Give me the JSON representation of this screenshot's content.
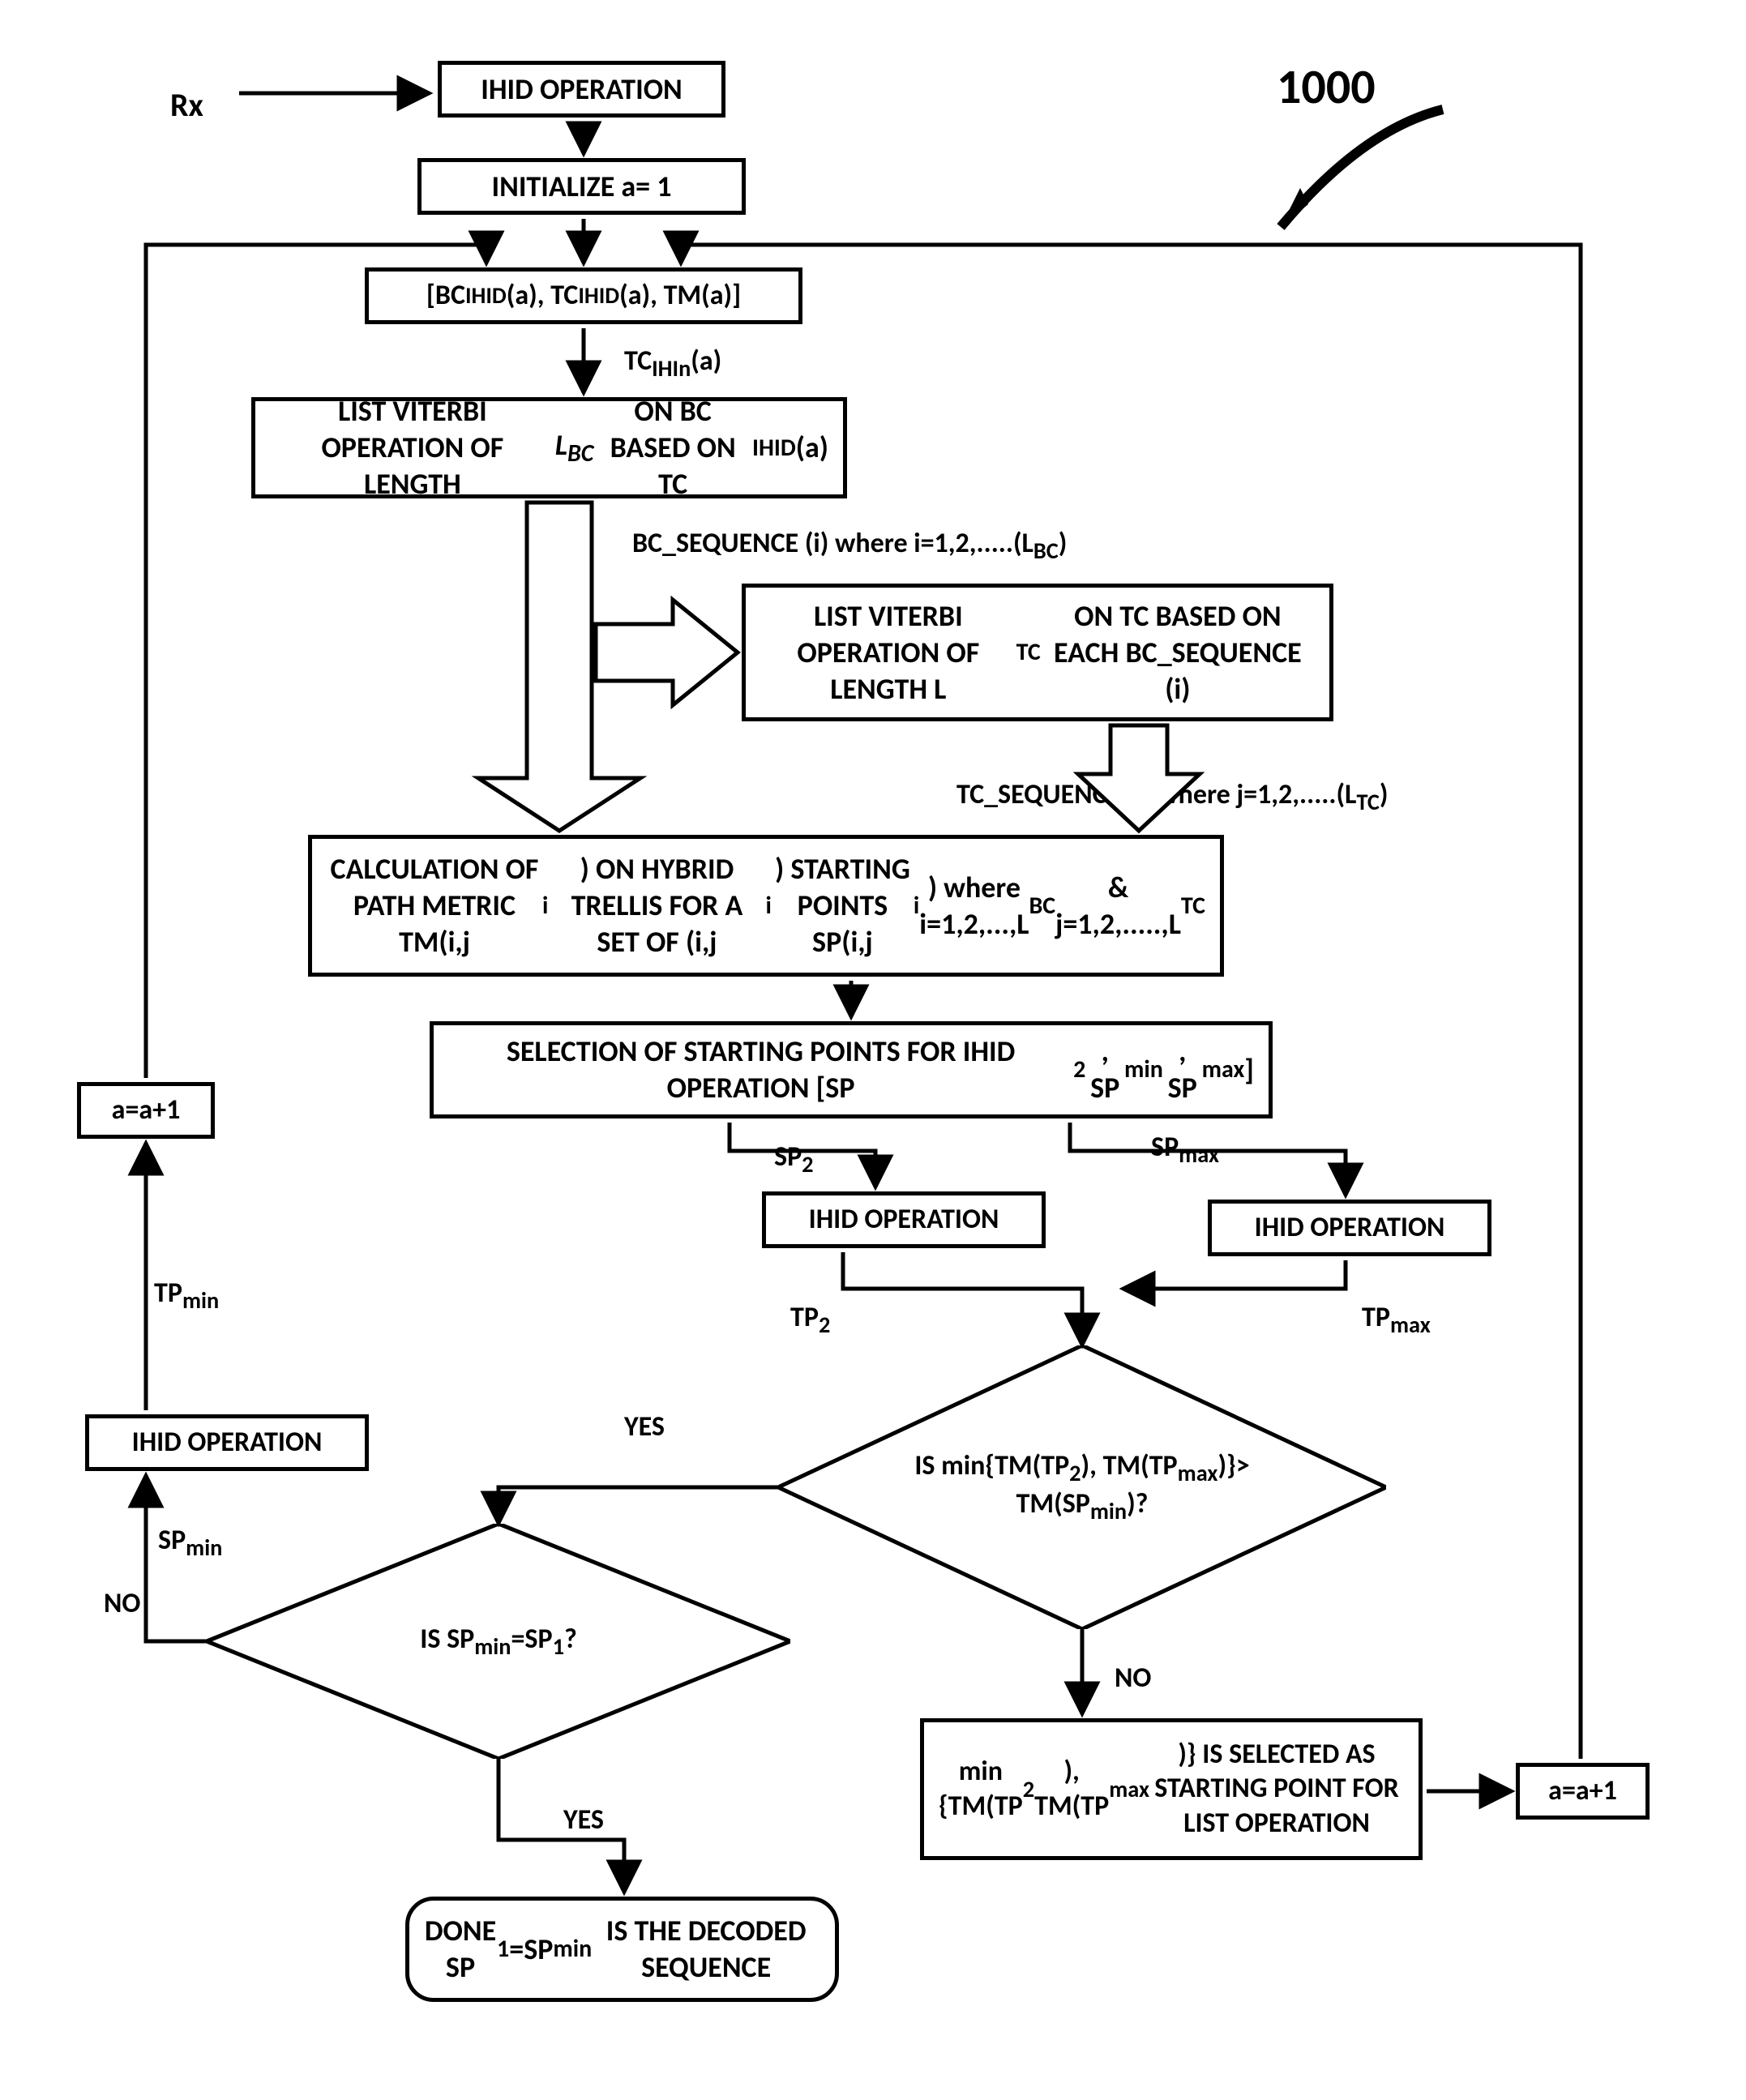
{
  "figure_number": "1000",
  "rx": "Rx",
  "steps": {
    "ihid_top": "IHID OPERATION",
    "init": "INITIALIZE  a= 1",
    "bc_tc_tm": "[BC<sub>IHID</sub>(a), TC<sub>IHID</sub>(a), TM(a)]",
    "tcihin": "TC<sub>IHIn</sub>(a)",
    "list_bc": "LIST VITERBI OPERATION OF LENGTH <span class='ital'>L<sub>BC</sub></span> ON BC BASED ON TC<sub>IHID</sub>(a)",
    "bc_seq_label": "BC_SEQUENCE (i) where i=1,2,.....(L<sub>BC</sub>)",
    "list_tc": "LIST VITERBI OPERATION OF LENGTH L<sub>TC</sub> ON TC BASED ON EACH BC_SEQUENCE (i)",
    "tc_seq_label": "TC_SEQUENCE (j) where j=1,2,.....(L<sub>TC</sub>)",
    "calc": "CALCULATION OF PATH METRIC TM(i,j<sub>i</sub>) ON HYBRID TRELLIS FOR A SET OF (i,j<sub>i</sub>) STARTING POINTS   SP(i,j<sub>i</sub>) where i=1,2,...,L<sub>BC</sub> & j=1,2,.....,L<sub>TC</sub>",
    "select_sp": "SELECTION OF STARTING POINTS FOR IHID OPERATION [SP<sub>2</sub>, SP<sub>min</sub>, SP<sub>max</sub>]",
    "sp2": "SP<sub>2</sub>",
    "spmax": "SP<sub>max</sub>",
    "ihid_sp2": "IHID OPERATION",
    "ihid_spmax": "IHID OPERATION",
    "tp2": "TP<sub>2</sub>",
    "tpmax": "TP<sub>max</sub>",
    "diamond1": "IS min{TM(TP<sub>2</sub>), TM(TP<sub>max</sub>)}&gt; TM(SP<sub>min</sub>)?",
    "no": "NO",
    "yes": "YES",
    "select_min": "min {TM(TP<sub>2</sub>), TM(TP<sub>max</sub>)} IS SELECTED AS STARTING POINT FOR LIST OPERATION",
    "a_plus_right": "a=a+1",
    "a_plus_left": "a=a+1",
    "tpmin": "TP<sub>min</sub>",
    "ihid_left": "IHID OPERATION",
    "spmin": "SP<sub>min</sub>",
    "diamond2": "IS SP<sub>min</sub>=SP<sub>1</sub>?",
    "done": "DONE SP<sub>1</sub>=SP<sub>min</sub> IS THE DECODED SEQUENCE"
  },
  "chart_data": {
    "type": "flowchart",
    "nodes": [
      {
        "id": "rx",
        "label": "Rx",
        "kind": "terminal"
      },
      {
        "id": "ihid_top",
        "label": "IHID OPERATION",
        "kind": "process"
      },
      {
        "id": "init",
        "label": "INITIALIZE a=1",
        "kind": "process"
      },
      {
        "id": "bc_tc_tm",
        "label": "[BC_IHID(a), TC_IHID(a), TM(a)]",
        "kind": "process"
      },
      {
        "id": "list_bc",
        "label": "LIST VITERBI OPERATION OF LENGTH L_BC ON BC BASED ON TC_IHID(a)",
        "kind": "process"
      },
      {
        "id": "list_tc",
        "label": "LIST VITERBI OPERATION OF LENGTH L_TC ON TC BASED ON EACH BC_SEQUENCE(i)",
        "kind": "process"
      },
      {
        "id": "calc",
        "label": "CALCULATION OF PATH METRIC TM(i,j_i) ON HYBRID TRELLIS FOR A SET OF (i,j_i) STARTING POINTS SP(i,j_i) where i=1..L_BC & j=1..L_TC",
        "kind": "process"
      },
      {
        "id": "select_sp",
        "label": "SELECTION OF STARTING POINTS FOR IHID OPERATION [SP_2, SP_min, SP_max]",
        "kind": "process"
      },
      {
        "id": "ihid_sp2",
        "label": "IHID OPERATION (from SP_2)",
        "kind": "process"
      },
      {
        "id": "ihid_spmax",
        "label": "IHID OPERATION (from SP_max)",
        "kind": "process"
      },
      {
        "id": "diamond1",
        "label": "IS min{TM(TP_2), TM(TP_max)} > TM(SP_min)?",
        "kind": "decision"
      },
      {
        "id": "select_min",
        "label": "min{TM(TP_2), TM(TP_max)} IS SELECTED AS STARTING POINT FOR LIST OPERATION",
        "kind": "process"
      },
      {
        "id": "a_plus_right",
        "label": "a=a+1",
        "kind": "process"
      },
      {
        "id": "ihid_left",
        "label": "IHID OPERATION (from SP_min)",
        "kind": "process"
      },
      {
        "id": "diamond2",
        "label": "IS SP_min = SP_1?",
        "kind": "decision"
      },
      {
        "id": "a_plus_left",
        "label": "a=a+1",
        "kind": "process"
      },
      {
        "id": "done",
        "label": "DONE SP_1=SP_min IS THE DECODED SEQUENCE",
        "kind": "terminal"
      }
    ],
    "edges": [
      {
        "from": "rx",
        "to": "ihid_top"
      },
      {
        "from": "ihid_top",
        "to": "init"
      },
      {
        "from": "init",
        "to": "bc_tc_tm"
      },
      {
        "from": "bc_tc_tm",
        "to": "list_bc",
        "label": "TC_IHIn(a)"
      },
      {
        "from": "list_bc",
        "to": "list_tc",
        "label": "BC_SEQUENCE(i), i=1..L_BC"
      },
      {
        "from": "list_bc",
        "to": "calc"
      },
      {
        "from": "list_tc",
        "to": "calc",
        "label": "TC_SEQUENCE(j), j=1..L_TC"
      },
      {
        "from": "calc",
        "to": "select_sp"
      },
      {
        "from": "select_sp",
        "to": "ihid_sp2",
        "label": "SP_2"
      },
      {
        "from": "select_sp",
        "to": "ihid_spmax",
        "label": "SP_max"
      },
      {
        "from": "ihid_sp2",
        "to": "diamond1",
        "label": "TP_2"
      },
      {
        "from": "ihid_spmax",
        "to": "diamond1",
        "label": "TP_max"
      },
      {
        "from": "diamond1",
        "to": "select_min",
        "label": "NO"
      },
      {
        "from": "select_min",
        "to": "a_plus_right"
      },
      {
        "from": "a_plus_right",
        "to": "bc_tc_tm"
      },
      {
        "from": "diamond1",
        "to": "diamond2",
        "label": "YES"
      },
      {
        "from": "diamond2",
        "to": "ihid_left",
        "label": "NO / SP_min"
      },
      {
        "from": "ihid_left",
        "to": "a_plus_left",
        "label": "TP_min"
      },
      {
        "from": "a_plus_left",
        "to": "bc_tc_tm"
      },
      {
        "from": "diamond2",
        "to": "done",
        "label": "YES"
      }
    ]
  }
}
